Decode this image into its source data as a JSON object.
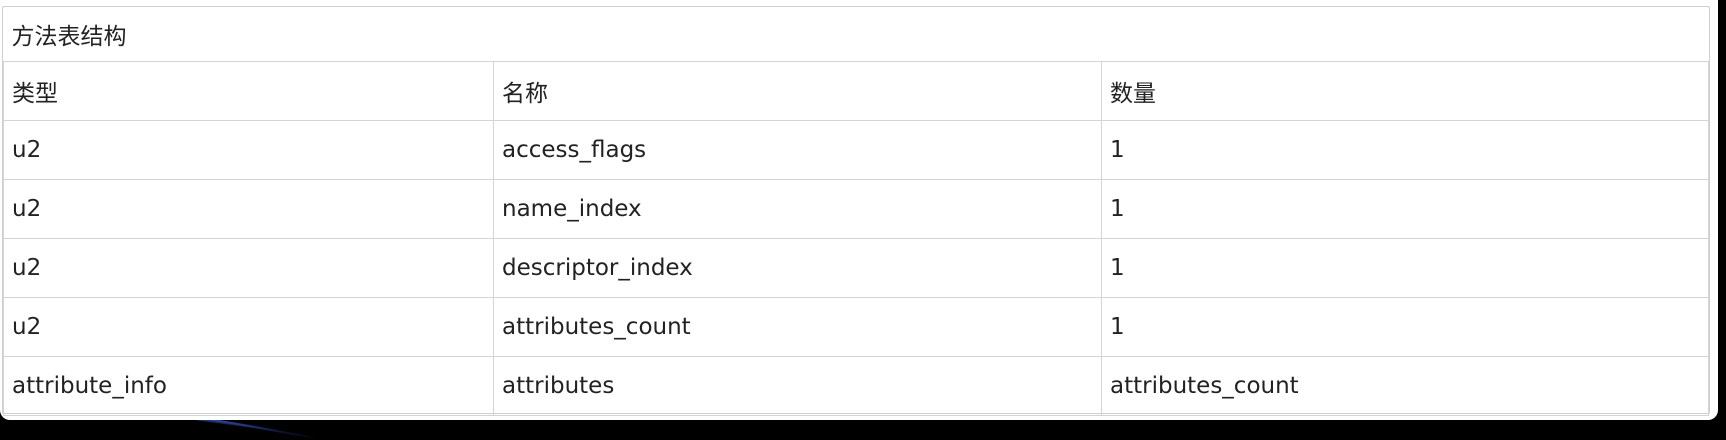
{
  "table": {
    "title": "方法表结构",
    "headers": [
      "类型",
      "名称",
      "数量"
    ],
    "rows": [
      [
        "u2",
        "access_flags",
        "1"
      ],
      [
        "u2",
        "name_index",
        "1"
      ],
      [
        "u2",
        "descriptor_index",
        "1"
      ],
      [
        "u2",
        "attributes_count",
        "1"
      ],
      [
        "attribute_info",
        "attributes",
        "attributes_count"
      ]
    ]
  }
}
